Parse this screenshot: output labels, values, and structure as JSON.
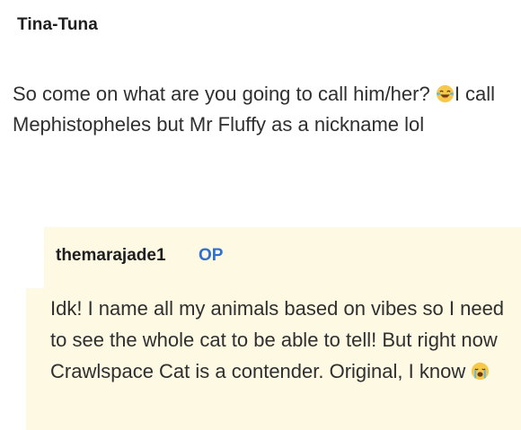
{
  "comment": {
    "author": "Tina-Tuna",
    "text_before_emoji": "So come on what are you going to call him/her? ",
    "emoji": "laughing-tears-emoji",
    "text_after_emoji": "I call Mephistopheles but Mr Fluffy as a nickname lol"
  },
  "reply": {
    "author": "themarajade1",
    "badge": "OP",
    "text": "Idk! I name all my animals based on vibes so I need to see the whole cat to be able to tell! But right now Crawlspace Cat is a contender. Original, I know ",
    "emoji": "loudly-crying-emoji",
    "background_color": "#fdf9e3",
    "badge_color": "#2f6fd0"
  }
}
